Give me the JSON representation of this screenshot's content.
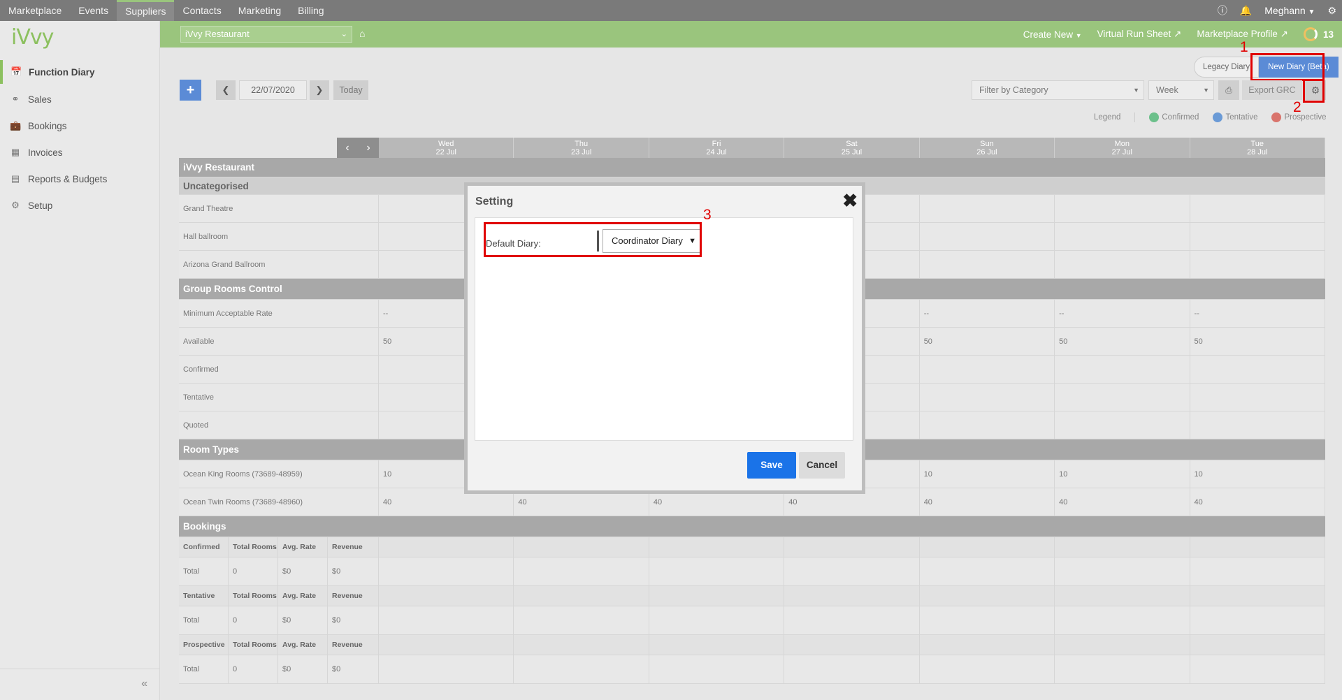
{
  "topnav": {
    "items": [
      "Marketplace",
      "Events",
      "Suppliers",
      "Contacts",
      "Marketing",
      "Billing"
    ],
    "active": "Suppliers",
    "user": "Meghann"
  },
  "sidebar": {
    "logo": "iVvy",
    "items": [
      {
        "label": "Function Diary",
        "icon": "calendar-icon"
      },
      {
        "label": "Sales",
        "icon": "handshake-icon"
      },
      {
        "label": "Bookings",
        "icon": "briefcase-icon"
      },
      {
        "label": "Invoices",
        "icon": "invoice-icon"
      },
      {
        "label": "Reports & Budgets",
        "icon": "bar-chart-icon"
      },
      {
        "label": "Setup",
        "icon": "gear-icon"
      }
    ],
    "collapse_glyph": "«"
  },
  "header": {
    "venue": "iVvy Restaurant",
    "create_new": "Create New",
    "virtual_run_sheet": "Virtual Run Sheet",
    "marketplace_profile": "Marketplace Profile",
    "counter": "13"
  },
  "diary_toggle": {
    "legacy": "Legacy Diary",
    "new": "New Diary (Beta)"
  },
  "annotations": {
    "one": "1",
    "two": "2",
    "three": "3"
  },
  "toolbar": {
    "add": "+",
    "date": "22/07/2020",
    "today": "Today",
    "filter_placeholder": "Filter by Category",
    "view": "Week",
    "export": "Export GRC"
  },
  "legend": {
    "title": "Legend",
    "items": [
      {
        "label": "Confirmed",
        "color": "#6cc08b"
      },
      {
        "label": "Tentative",
        "color": "#6a9ad6"
      },
      {
        "label": "Prospective",
        "color": "#d9746c"
      }
    ]
  },
  "days": [
    {
      "dow": "Wed",
      "date": "22 Jul"
    },
    {
      "dow": "Thu",
      "date": "23 Jul"
    },
    {
      "dow": "Fri",
      "date": "24 Jul"
    },
    {
      "dow": "Sat",
      "date": "25 Jul"
    },
    {
      "dow": "Sun",
      "date": "26 Jul"
    },
    {
      "dow": "Mon",
      "date": "27 Jul"
    },
    {
      "dow": "Tue",
      "date": "28 Jul"
    }
  ],
  "grid": {
    "venue": "iVvy Restaurant",
    "uncategorised": "Uncategorised",
    "spaces": [
      "Grand Theatre",
      "Hall ballroom",
      "Arizona Grand Ballroom"
    ],
    "grc": "Group Rooms Control",
    "grc_rows": [
      {
        "label": "Minimum Acceptable Rate",
        "values": [
          "--",
          "",
          "",
          "",
          "--",
          "--",
          "--"
        ]
      },
      {
        "label": "Available",
        "values": [
          "50",
          "",
          "",
          "",
          "50",
          "50",
          "50"
        ]
      },
      {
        "label": "Confirmed",
        "values": [
          "",
          "",
          "",
          "",
          "",
          "",
          ""
        ]
      },
      {
        "label": "Tentative",
        "values": [
          "",
          "",
          "",
          "",
          "",
          "",
          ""
        ]
      },
      {
        "label": "Quoted",
        "values": [
          "",
          "",
          "",
          "",
          "",
          "",
          ""
        ]
      }
    ],
    "room_types": "Room Types",
    "room_rows": [
      {
        "label": "Ocean King Rooms (73689-48959)",
        "values": [
          "10",
          "",
          "",
          "",
          "10",
          "10",
          "10"
        ]
      },
      {
        "label": "Ocean Twin Rooms (73689-48960)",
        "values": [
          "40",
          "40",
          "40",
          "40",
          "40",
          "40",
          "40"
        ]
      }
    ],
    "bookings": "Bookings",
    "booking_groups": [
      {
        "head": [
          "Confirmed",
          "Total Rooms",
          "Avg. Rate",
          "Revenue"
        ],
        "total": [
          "Total",
          "0",
          "$0",
          "$0"
        ]
      },
      {
        "head": [
          "Tentative",
          "Total Rooms",
          "Avg. Rate",
          "Revenue"
        ],
        "total": [
          "Total",
          "0",
          "$0",
          "$0"
        ]
      },
      {
        "head": [
          "Prospective",
          "Total Rooms",
          "Avg. Rate",
          "Revenue"
        ],
        "total": [
          "Total",
          "0",
          "$0",
          "$0"
        ]
      }
    ]
  },
  "modal": {
    "title": "Setting",
    "default_diary_label": "Default Diary:",
    "default_diary_value": "Coordinator Diary",
    "save": "Save",
    "cancel": "Cancel"
  }
}
